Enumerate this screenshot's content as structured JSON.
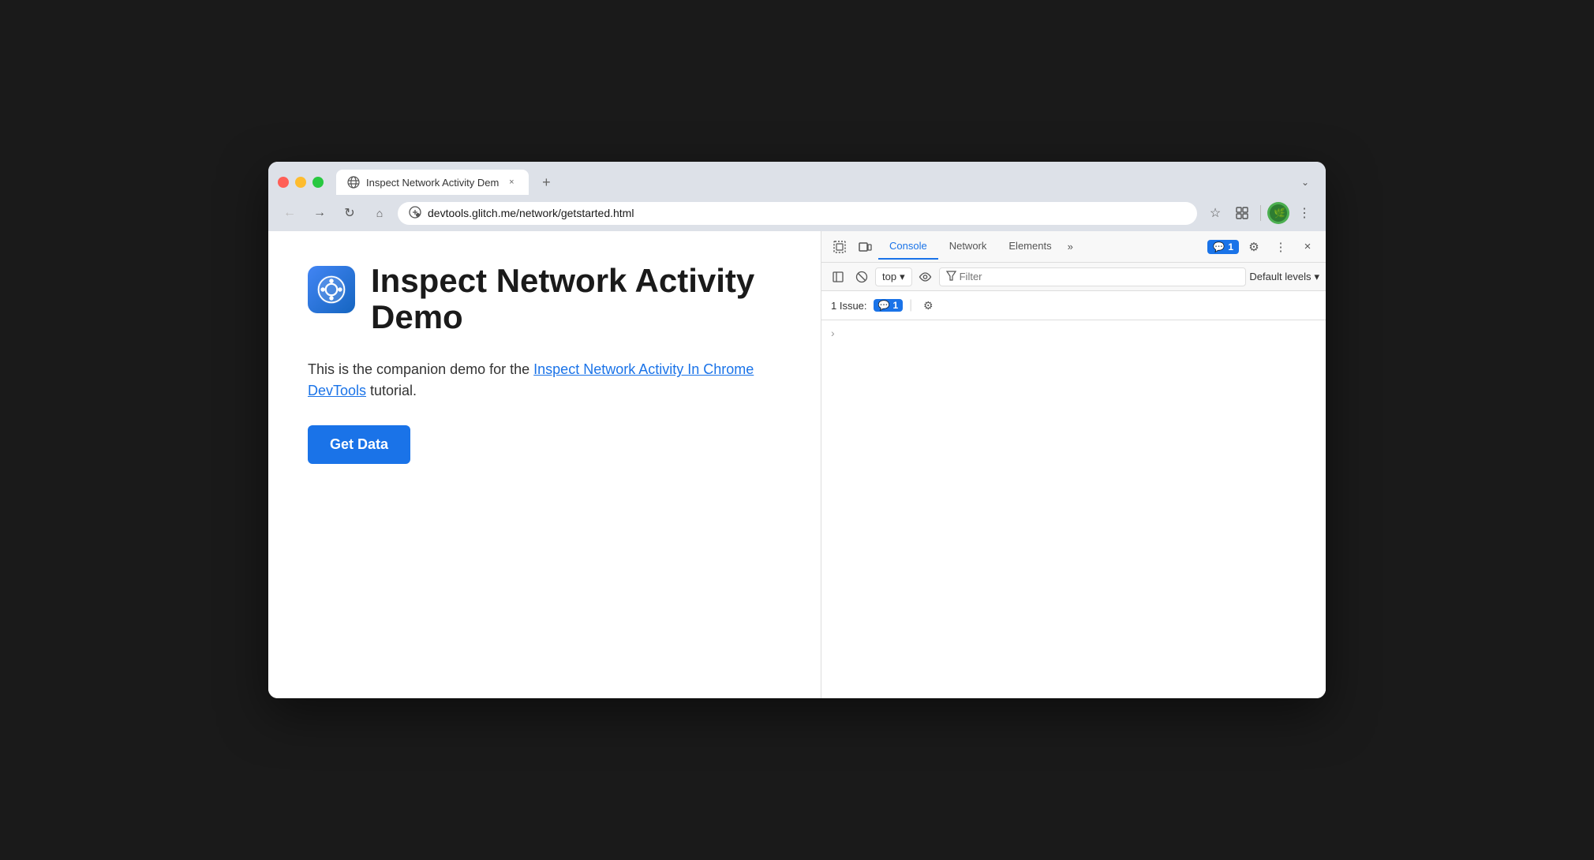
{
  "browser": {
    "tab": {
      "favicon": "globe",
      "title": "Inspect Network Activity Dem",
      "close_label": "×",
      "new_tab_label": "+"
    },
    "tab_dropdown_label": "⌄",
    "nav": {
      "back_label": "←",
      "forward_label": "→",
      "reload_label": "↻",
      "home_label": "⌂",
      "address_icon": "⊙",
      "url": "devtools.glitch.me/network/getstarted.html",
      "bookmark_label": "☆",
      "extensions_label": "🧩",
      "profile_label": "🌿",
      "menu_label": "⋮"
    }
  },
  "page": {
    "title": "Inspect Network Activity Demo",
    "description_before": "This is the companion demo for the ",
    "link_text": "Inspect Network Activity In Chrome DevTools",
    "description_after": " tutorial.",
    "button_label": "Get Data"
  },
  "devtools": {
    "toolbar": {
      "inspect_icon": "⬚",
      "device_icon": "⬜",
      "tabs": [
        "Console",
        "Network",
        "Elements"
      ],
      "more_label": "»",
      "badge_icon": "💬",
      "badge_count": "1",
      "settings_label": "⚙",
      "more_options_label": "⋮",
      "close_label": "×"
    },
    "console_toolbar": {
      "sidebar_icon": "⬚",
      "clear_icon": "🚫",
      "top_label": "top",
      "eye_icon": "👁",
      "filter_placeholder": "Filter",
      "default_levels_label": "Default levels",
      "dropdown_icon": "▾"
    },
    "issues": {
      "label": "1 Issue:",
      "badge_icon": "💬",
      "badge_count": "1",
      "settings_label": "⚙"
    },
    "console_content": {
      "arrow_label": "›"
    }
  }
}
